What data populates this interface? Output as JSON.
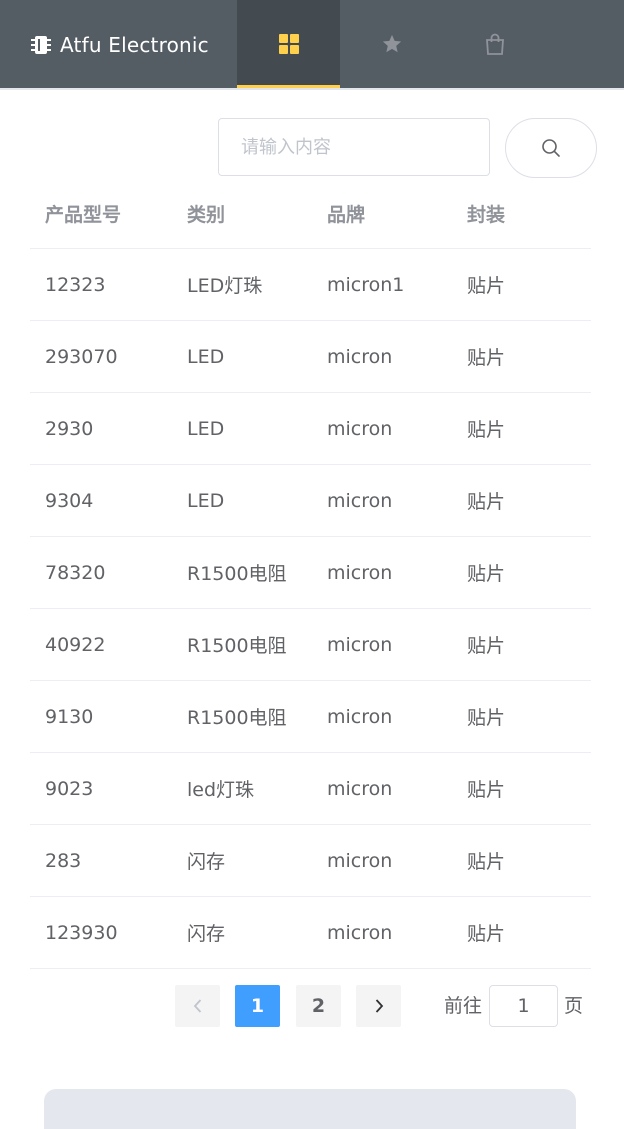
{
  "header": {
    "brand": "Atfu Electronic",
    "tabs": [
      {
        "icon": "grid-icon",
        "active": true
      },
      {
        "icon": "star-icon",
        "active": false
      },
      {
        "icon": "shopping-bag-icon",
        "active": false
      }
    ],
    "accent": "#ffd04b"
  },
  "search": {
    "placeholder": "请输入内容",
    "value": ""
  },
  "table": {
    "headers": [
      "产品型号",
      "类别",
      "品牌",
      "封装"
    ],
    "rows": [
      [
        "12323",
        "LED灯珠",
        "micron1",
        "贴片"
      ],
      [
        "293070",
        "LED",
        "micron",
        "贴片"
      ],
      [
        "2930",
        "LED",
        "micron",
        "贴片"
      ],
      [
        "9304",
        "LED",
        "micron",
        "贴片"
      ],
      [
        "78320",
        "R1500电阻",
        "micron",
        "贴片"
      ],
      [
        "40922",
        "R1500电阻",
        "micron",
        "贴片"
      ],
      [
        "9130",
        "R1500电阻",
        "micron",
        "贴片"
      ],
      [
        "9023",
        "led灯珠",
        "micron",
        "贴片"
      ],
      [
        "283",
        "闪存",
        "micron",
        "贴片"
      ],
      [
        "123930",
        "闪存",
        "micron",
        "贴片"
      ]
    ]
  },
  "pagination": {
    "pages": [
      "1",
      "2"
    ],
    "current": "1",
    "goto_label": "前往",
    "goto_value": "1",
    "page_suffix": "页",
    "active_color": "#409eff"
  }
}
